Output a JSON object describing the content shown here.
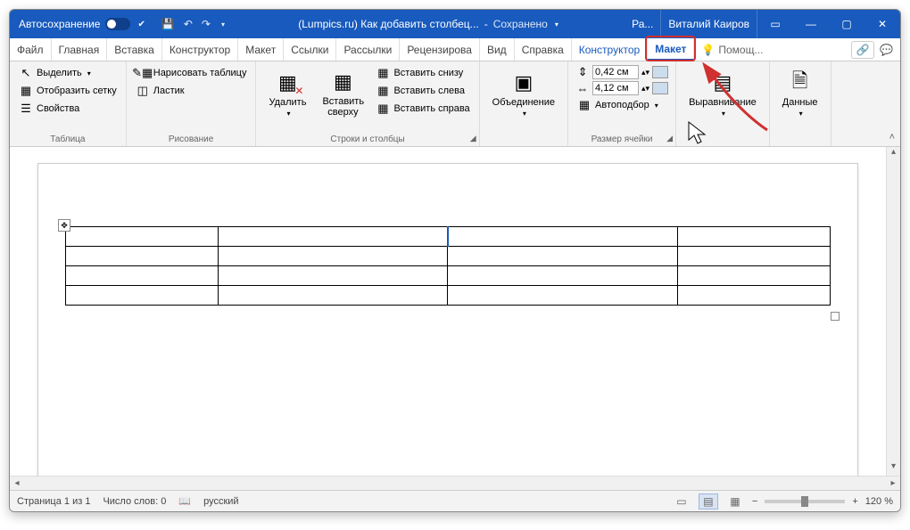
{
  "titlebar": {
    "autosave": "Автосохранение",
    "doc_title": "(Lumpics.ru) Как добавить столбец...",
    "saved_status": "Сохранено",
    "search_short": "Ра...",
    "username": "Виталий Каиров"
  },
  "tabs": {
    "file": "Файл",
    "home": "Главная",
    "insert": "Вставка",
    "constructor": "Конструктор",
    "layout": "Макет",
    "references": "Ссылки",
    "mailings": "Рассылки",
    "review": "Рецензирова",
    "view": "Вид",
    "help": "Справка",
    "table_constructor": "Конструктор",
    "table_layout": "Макет",
    "search_ph": "Помощ..."
  },
  "ribbon": {
    "table_group": "Таблица",
    "select": "Выделить",
    "show_grid": "Отобразить сетку",
    "properties": "Свойства",
    "draw_group": "Рисование",
    "draw_table": "Нарисовать таблицу",
    "eraser": "Ластик",
    "delete": "Удалить",
    "rows_cols_group": "Строки и столбцы",
    "insert_above": "Вставить сверху",
    "insert_below": "Вставить снизу",
    "insert_left": "Вставить слева",
    "insert_right": "Вставить справа",
    "merge": "Объединение",
    "cell_size_group": "Размер ячейки",
    "row_h": "0,42 см",
    "col_w": "4,12 см",
    "autofit": "Автоподбор",
    "alignment": "Выравнивание",
    "data": "Данные"
  },
  "status": {
    "page": "Страница 1 из 1",
    "words": "Число слов: 0",
    "lang": "русский",
    "zoom": "120 %"
  }
}
